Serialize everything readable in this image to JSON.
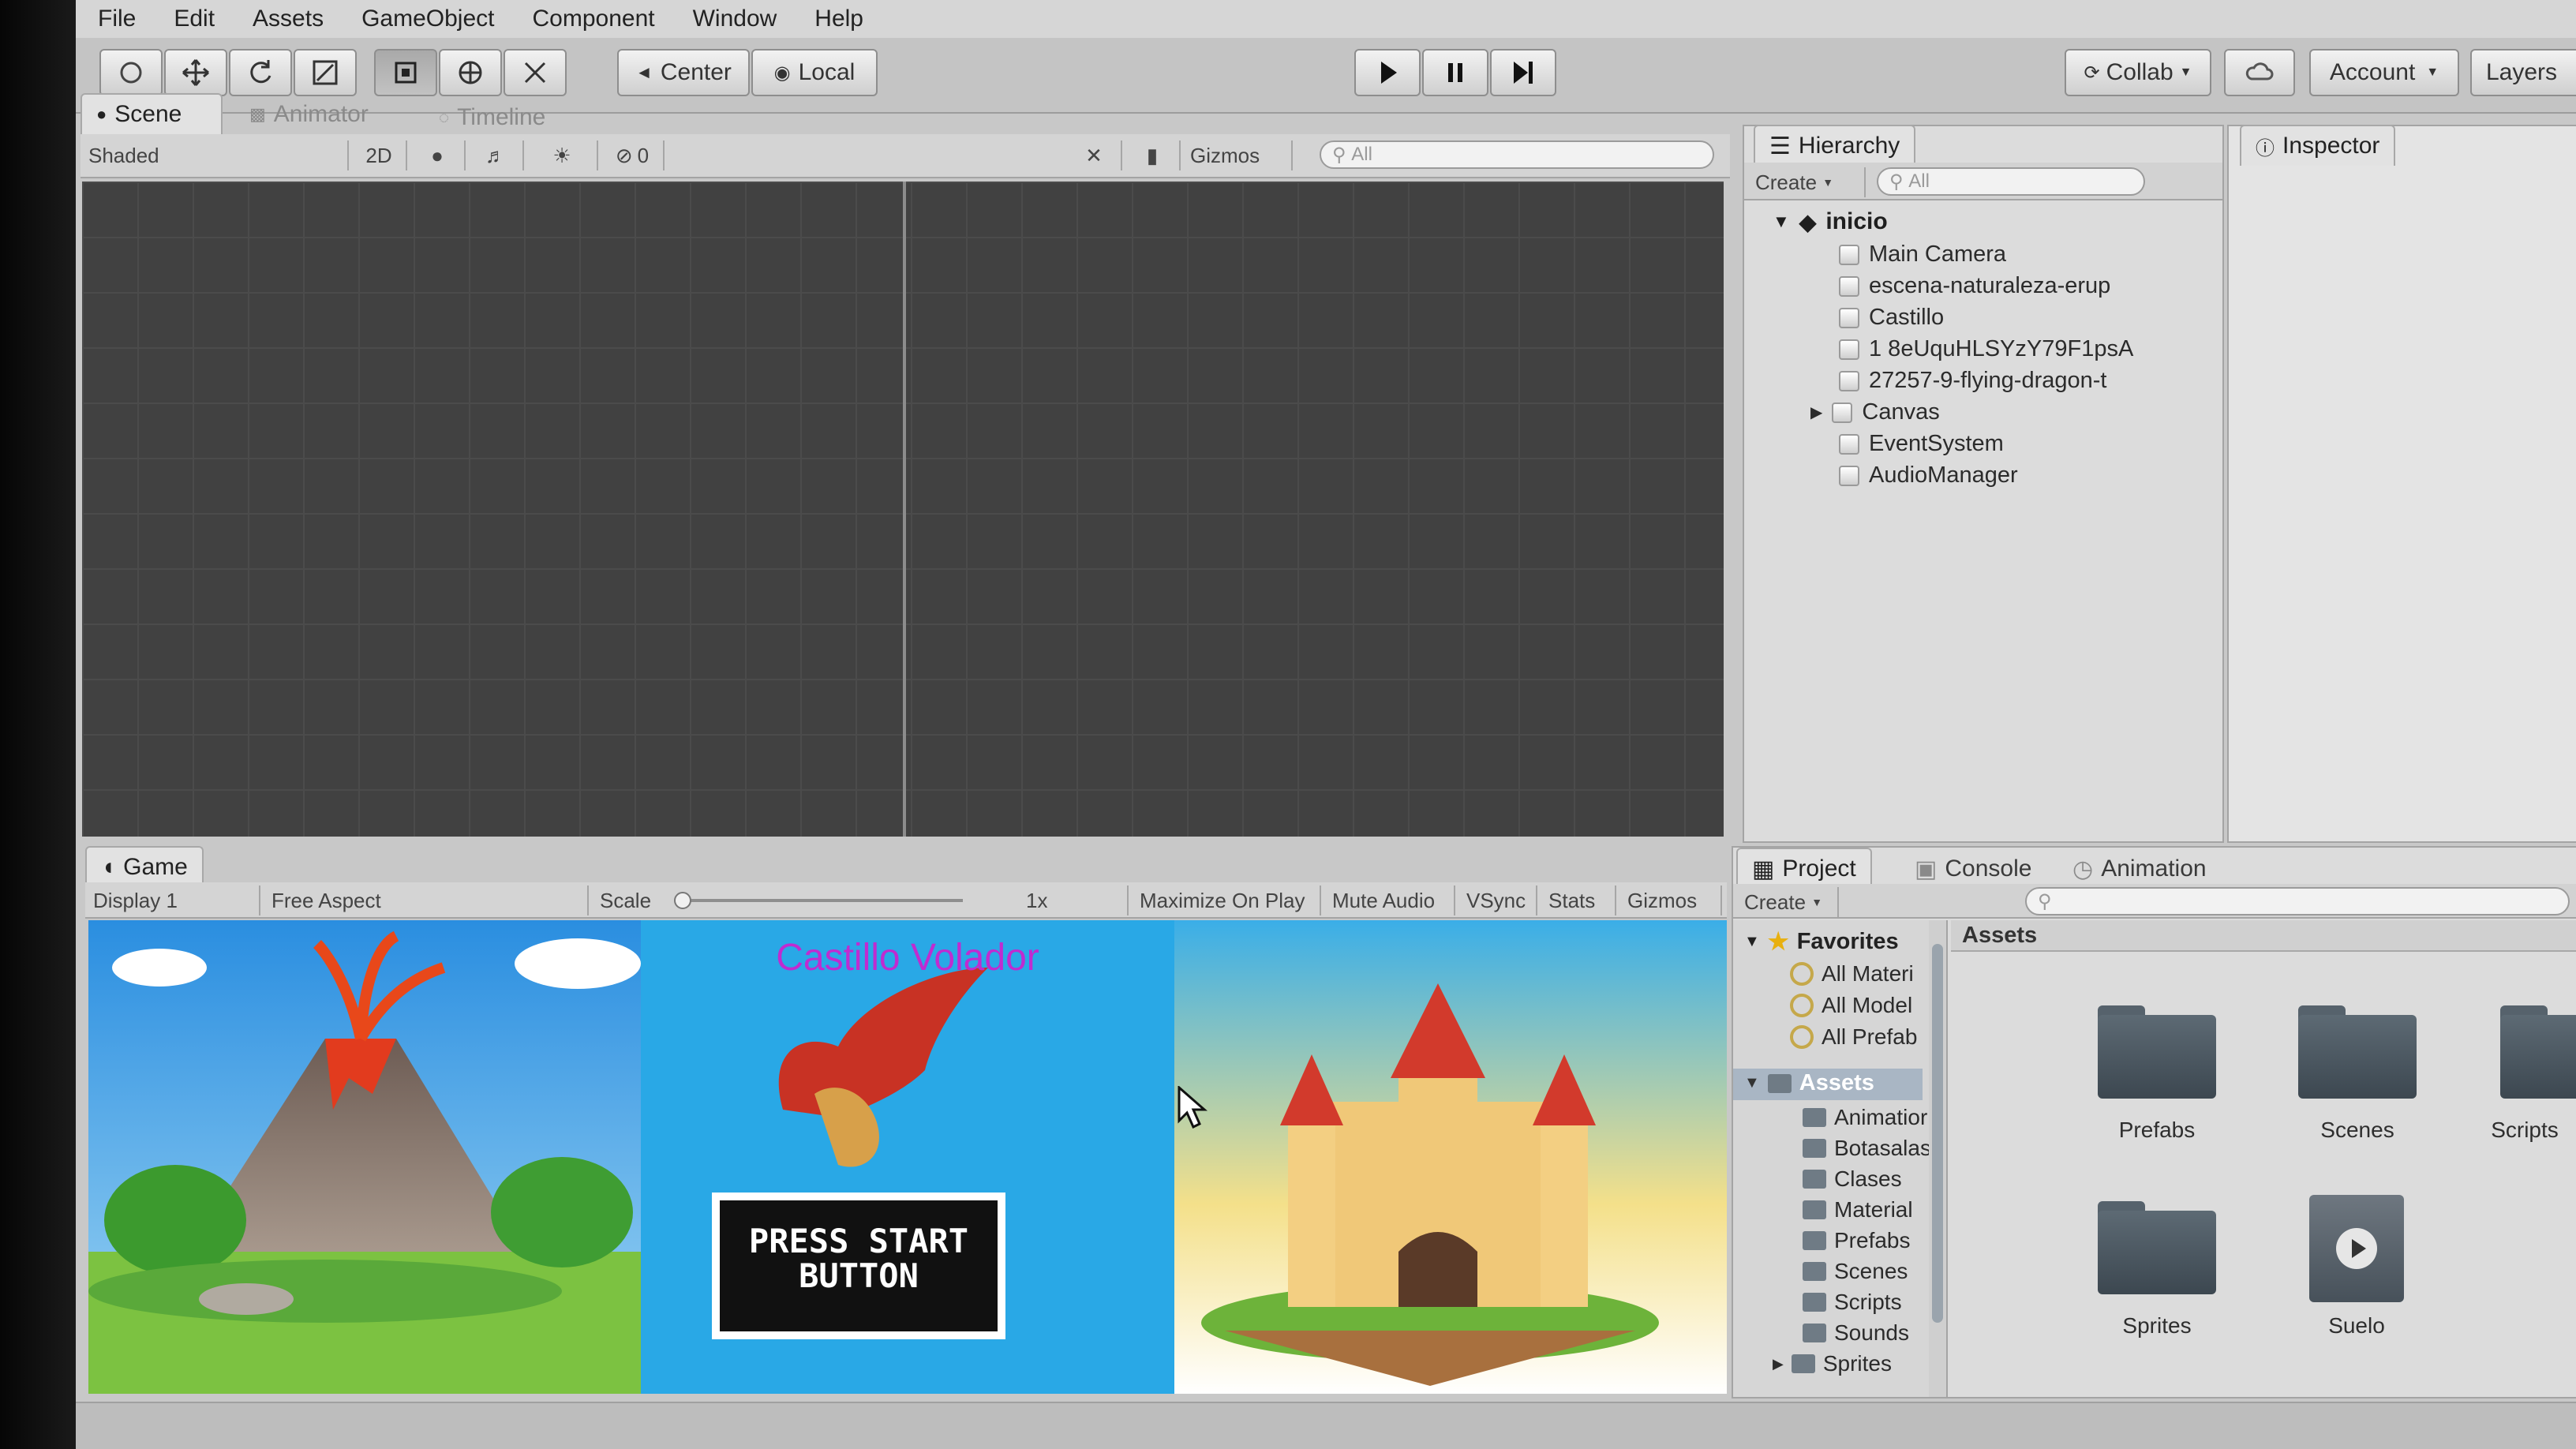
{
  "menu": [
    "File",
    "Edit",
    "Assets",
    "GameObject",
    "Component",
    "Window",
    "Help"
  ],
  "toolbar": {
    "pivot_center": "Center",
    "pivot_local": "Local",
    "collab": "Collab",
    "account": "Account",
    "layers": "Layers"
  },
  "scene_tabs": [
    "Scene",
    "Animator",
    "Timeline"
  ],
  "scene_bar": {
    "shading": "Shaded",
    "mode_2d": "2D",
    "effects_count": "0",
    "gizmos": "Gizmos",
    "search": "All"
  },
  "hierarchy": {
    "tab": "Hierarchy",
    "create": "Create",
    "search": "All",
    "scene_name": "inicio",
    "items": [
      "Main Camera",
      "escena-naturaleza-erup",
      "Castillo",
      "1 8eUquHLSYzY79F1psA",
      "27257-9-flying-dragon-t",
      "Canvas",
      "EventSystem",
      "AudioManager"
    ]
  },
  "inspector": {
    "tab": "Inspector"
  },
  "game": {
    "tab": "Game",
    "display": "Display 1",
    "aspect": "Free Aspect",
    "scale_label": "Scale",
    "scale_value": "1x",
    "toggles": [
      "Maximize On Play",
      "Mute Audio",
      "VSync",
      "Stats",
      "Gizmos"
    ],
    "title": "Castillo Volador",
    "start_line1": "PRESS START",
    "start_line2": "BUTTON"
  },
  "project": {
    "tabs": [
      "Project",
      "Console",
      "Animation"
    ],
    "create": "Create",
    "favorites_label": "Favorites",
    "favorites": [
      "All Materi",
      "All Model",
      "All Prefab"
    ],
    "assets_label": "Assets",
    "tree": [
      "Animatior",
      "Botasalas",
      "Clases",
      "Material",
      "Prefabs",
      "Scenes",
      "Scripts",
      "Sounds",
      "Sprites"
    ],
    "breadcrumb": "Assets",
    "grid": [
      "Prefabs",
      "Scenes",
      "Scripts",
      "Sprites",
      "Suelo"
    ]
  },
  "colors": {
    "scene_bg": "#414141",
    "editor_gray": "#c8c8c8",
    "sky_blue": "#29a8e6",
    "title_magenta": "#c02bd0"
  }
}
